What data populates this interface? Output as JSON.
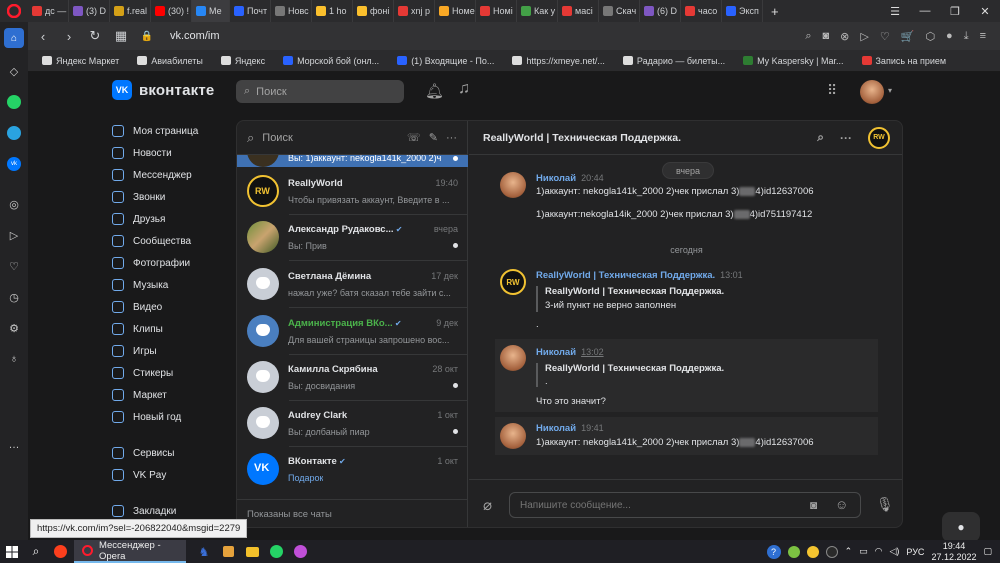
{
  "browser": {
    "tabs": [
      {
        "label": "дс —",
        "color": "#e53935"
      },
      {
        "label": "(3) D",
        "color": "#7e57c2"
      },
      {
        "label": "f.real",
        "color": "#d4a017"
      },
      {
        "label": "(30) !",
        "color": "#ff0000"
      },
      {
        "label": "Ме",
        "color": "#2787f5"
      },
      {
        "label": "Почт",
        "color": "#2962ff"
      },
      {
        "label": "Новс",
        "color": "#777777"
      },
      {
        "label": "1 ho",
        "color": "#fbc02d"
      },
      {
        "label": "фоні",
        "color": "#fbc02d"
      },
      {
        "label": "xnj p",
        "color": "#e53935"
      },
      {
        "label": "Номе",
        "color": "#f9a825"
      },
      {
        "label": "Номі",
        "color": "#e53935"
      },
      {
        "label": "Как у",
        "color": "#43a047"
      },
      {
        "label": "масі",
        "color": "#e53935"
      },
      {
        "label": "Скач",
        "color": "#777777"
      },
      {
        "label": "(6) D",
        "color": "#7e57c2"
      },
      {
        "label": "часо",
        "color": "#e53935"
      },
      {
        "label": "Эксп",
        "color": "#2962ff"
      }
    ],
    "active_tab_index": 4,
    "new_tab": "+",
    "url": "vk.com/im",
    "bookmarks": [
      {
        "label": "Яндекс Маркет",
        "color": "#dddddd"
      },
      {
        "label": "Авиабилеты",
        "color": "#dddddd"
      },
      {
        "label": "Яндекс",
        "color": "#dddddd"
      },
      {
        "label": "Морской бой (онл...",
        "color": "#2962ff"
      },
      {
        "label": "(1) Входящие - По...",
        "color": "#2962ff"
      },
      {
        "label": "https://xmeye.net/...",
        "color": "#dddddd"
      },
      {
        "label": "Радарио — билеты...",
        "color": "#dddddd"
      },
      {
        "label": "My Kaspersky | Mar...",
        "color": "#2e7d32"
      },
      {
        "label": "Запись на прием",
        "color": "#e53935"
      }
    ],
    "status_url": "https://vk.com/im?sel=-206822040&msgid=2279"
  },
  "vk": {
    "logo_text": "вконтакте",
    "search_placeholder": "Поиск",
    "menu": [
      "Моя страница",
      "Новости",
      "Мессенджер",
      "Звонки",
      "Друзья",
      "Сообщества",
      "Фотографии",
      "Музыка",
      "Видео",
      "Клипы",
      "Игры",
      "Стикеры",
      "Маркет",
      "Новый год"
    ],
    "menu2": [
      "Сервисы",
      "VK Pay"
    ],
    "menu3": [
      "Закладки"
    ],
    "conv_search_placeholder": "Поиск",
    "conversations_partial": "Вы: 1)аккаунт: nekogla141k_2000 2)ч",
    "conversations": [
      {
        "name": "ReallyWorld",
        "time": "19:40",
        "preview": "Чтобы привязать аккаунт, Введите в ...",
        "avatar": "rw",
        "dot": false
      },
      {
        "name": "Александр Рудаковс...",
        "time": "вчера",
        "preview": "Вы: Прив",
        "avatar": "photo",
        "dot": true,
        "verified": true
      },
      {
        "name": "Светлана Дёмина",
        "time": "17 дек",
        "preview": "нажал уже? батя сказал тебе зайти с...",
        "avatar": "dog",
        "dot": false
      },
      {
        "name": "Администрация ВКо...",
        "time": "9 дек",
        "preview": "Для вашей страницы запрошено вос...",
        "avatar": "blue",
        "dot": false,
        "verified": true,
        "green": true
      },
      {
        "name": "Камилла Скрябина",
        "time": "28 окт",
        "preview": "Вы: досвидания",
        "avatar": "dog",
        "dot": true
      },
      {
        "name": "Audrey Clark",
        "time": "1 окт",
        "preview": "Вы: долбаный пиар",
        "avatar": "dog",
        "dot": true
      },
      {
        "name": "ВКонтакте",
        "time": "1 окт",
        "preview": "Подарок",
        "avatar": "vk",
        "dot": false,
        "verified": true,
        "link": true
      }
    ],
    "conv_footer": "Показаны все чаты",
    "chat": {
      "title": "ReallyWorld | Техническая Поддержка.",
      "date_yesterday": "вчера",
      "date_today": "сегодня",
      "msg1": {
        "author": "Николай",
        "time": "20:44",
        "line1_a": "1)аккаунт: nekogla141k_2000 2)чек прислал 3)",
        "line1_b": "4)id12637006",
        "line2_a": "1)аккаунт:nekogla14ik_2000 2)чек прислал 3)",
        "line2_b": "4)id751197412"
      },
      "msg2": {
        "author": "ReallyWorld | Техническая Поддержка.",
        "time": "13:01",
        "quote_author": "ReallyWorld | Техническая Поддержка.",
        "quote_text": "3-ий пункт не верно заполнен",
        "text": "."
      },
      "msg3": {
        "author": "Николай",
        "time": "13:02",
        "quote_author": "ReallyWorld | Техническая Поддержка.",
        "quote_text": ".",
        "text": "Что это значит?"
      },
      "msg4": {
        "author": "Николай",
        "time": "19:41",
        "line_a": "1)аккаунт: nekogla141k_2000 2)чек прислал 3)",
        "line_b": "4)id12637006"
      },
      "input_placeholder": "Напишите сообщение..."
    }
  },
  "taskbar": {
    "app_label": "Мессенджер - Opera",
    "lang": "РУС",
    "time": "19:44",
    "date": "27.12.2022"
  },
  "colors": {
    "accent": "#71aaeb",
    "vk_blue": "#0077ff",
    "opera_red": "#ff1b2d"
  }
}
